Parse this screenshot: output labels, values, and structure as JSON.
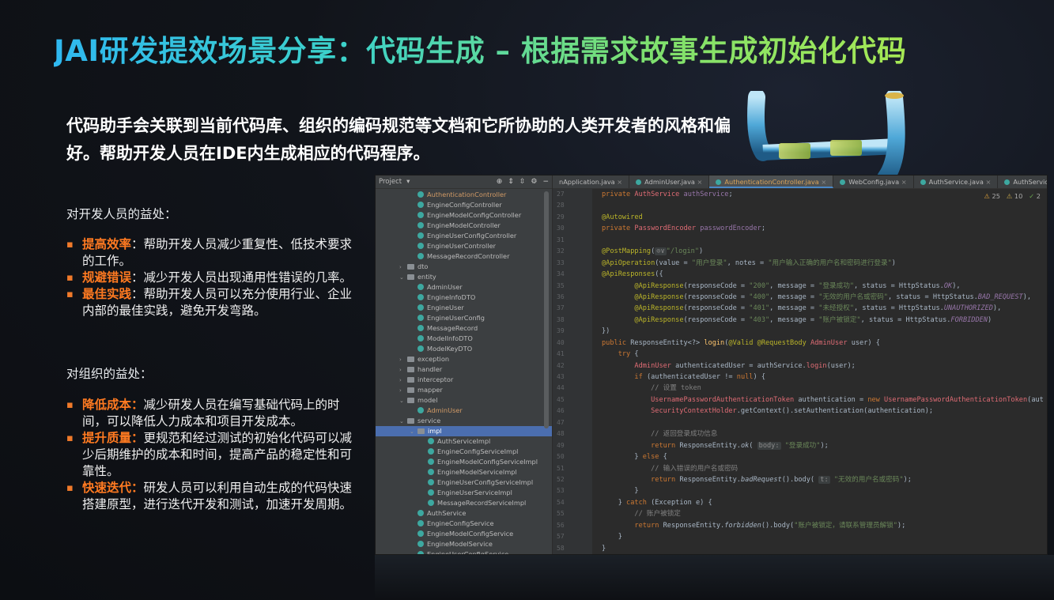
{
  "title": "JAI研发提效场景分享：代码生成 – 根据需求故事生成初始化代码",
  "intro": "代码助手会关联到当前代码库、组织的编码规范等文档和它所协助的人类开发者的风格和偏好。帮助开发人员在IDE内生成相应的代码程序。",
  "dev": {
    "heading": "对开发人员的益处：",
    "items": [
      {
        "label": "提高效率",
        "text": "：帮助开发人员减少重复性、低技术要求的工作。"
      },
      {
        "label": "规避错误",
        "text": "：减少开发人员出现通用性错误的几率。"
      },
      {
        "label": "最佳实践",
        "text": "：帮助开发人员可以充分使用行业、企业内部的最佳实践，避免开发弯路。"
      }
    ]
  },
  "org": {
    "heading": "对组织的益处：",
    "items": [
      {
        "label": "降低成本：",
        "text": "减少研发人员在编写基础代码上的时间，可以降低人力成本和项目开发成本。"
      },
      {
        "label": "提升质量：",
        "text": "更规范和经过测试的初始化代码可以减少后期维护的成本和时间，提高产品的稳定性和可靠性。"
      },
      {
        "label": "快速迭代：",
        "text": "研发人员可以利用自动生成的代码快速搭建原型，进行迭代开发和测试，加速开发周期。"
      }
    ]
  },
  "ide": {
    "project_label": "Project",
    "tabs": [
      "nApplication.java",
      "AdminUser.java",
      "AuthenticationController.java",
      "WebConfig.java",
      "AuthService.java",
      "AuthServiceImpl.java"
    ],
    "active_tab": 2,
    "status": {
      "warnings": "25",
      "weak": "10",
      "typos": "2"
    },
    "tree": [
      {
        "t": "AuthenticationController",
        "k": "c",
        "d": 5,
        "o": true
      },
      {
        "t": "EngineConfigController",
        "k": "c",
        "d": 5
      },
      {
        "t": "EngineModelConfigController",
        "k": "c",
        "d": 5
      },
      {
        "t": "EngineModelController",
        "k": "c",
        "d": 5
      },
      {
        "t": "EngineUserConfigController",
        "k": "c",
        "d": 5
      },
      {
        "t": "EngineUserController",
        "k": "c",
        "d": 5
      },
      {
        "t": "MessageRecordController",
        "k": "c",
        "d": 5
      },
      {
        "t": "dto",
        "k": "f",
        "d": 4,
        "a": "›"
      },
      {
        "t": "entity",
        "k": "f",
        "d": 4,
        "a": "⌄"
      },
      {
        "t": "AdminUser",
        "k": "c",
        "d": 5
      },
      {
        "t": "EngineInfoDTO",
        "k": "c",
        "d": 5
      },
      {
        "t": "EngineUser",
        "k": "c",
        "d": 5
      },
      {
        "t": "EngineUserConfig",
        "k": "c",
        "d": 5
      },
      {
        "t": "MessageRecord",
        "k": "c",
        "d": 5
      },
      {
        "t": "ModelInfoDTO",
        "k": "c",
        "d": 5
      },
      {
        "t": "ModelKeyDTO",
        "k": "c",
        "d": 5
      },
      {
        "t": "exception",
        "k": "f",
        "d": 4,
        "a": "›"
      },
      {
        "t": "handler",
        "k": "f",
        "d": 4,
        "a": "›"
      },
      {
        "t": "interceptor",
        "k": "f",
        "d": 4,
        "a": "›"
      },
      {
        "t": "mapper",
        "k": "f",
        "d": 4,
        "a": "›"
      },
      {
        "t": "model",
        "k": "f",
        "d": 4,
        "a": "⌄"
      },
      {
        "t": "AdminUser",
        "k": "c",
        "d": 5,
        "o": true
      },
      {
        "t": "service",
        "k": "f",
        "d": 4,
        "a": "⌄"
      },
      {
        "t": "impl",
        "k": "f",
        "d": 5,
        "a": "⌄",
        "s": true
      },
      {
        "t": "AuthServiceImpl",
        "k": "c",
        "d": 6
      },
      {
        "t": "EngineConfigServiceImpl",
        "k": "c",
        "d": 6
      },
      {
        "t": "EngineModelConfigServiceImpl",
        "k": "c",
        "d": 6
      },
      {
        "t": "EngineModelServiceImpl",
        "k": "c",
        "d": 6
      },
      {
        "t": "EngineUserConfigServiceImpl",
        "k": "c",
        "d": 6
      },
      {
        "t": "EngineUserServiceImpl",
        "k": "c",
        "d": 6
      },
      {
        "t": "MessageRecordServiceImpl",
        "k": "c",
        "d": 6
      },
      {
        "t": "AuthService",
        "k": "c",
        "d": 5
      },
      {
        "t": "EngineConfigService",
        "k": "c",
        "d": 5
      },
      {
        "t": "EngineModelConfigService",
        "k": "c",
        "d": 5
      },
      {
        "t": "EngineModelService",
        "k": "c",
        "d": 5
      },
      {
        "t": "EngineUserConfigService",
        "k": "c",
        "d": 5
      }
    ],
    "line_numbers": [
      "27",
      "28",
      "29",
      "30",
      "31",
      "32",
      "33",
      "34",
      "35",
      "36",
      "37",
      "38",
      "39",
      "40",
      "41",
      "42",
      "43",
      "44",
      "45",
      "46",
      "47",
      "48",
      "49",
      "50",
      "51",
      "52",
      "53",
      "54",
      "55",
      "56",
      "57",
      "58"
    ],
    "code": [
      "<span class=kw>private</span> <span class=red>AuthService</span> <span class=fld>authService</span>;",
      "",
      "<span class=an>@Autowired</span>",
      "<span class=kw>private</span> <span class=red>PasswordEncoder</span> <span class=fld>passwordEncoder</span>;",
      "",
      "<span class=an>@PostMapping</span>(<span class=hint>⊙∨</span><span class=str>\"/login\"</span>)",
      "<span class=an>@ApiOperation</span>(value = <span class=str>\"用户登录\"</span>, notes = <span class=str>\"用户输入正确的用户名和密码进行登录\"</span>)",
      "<span class=an>@ApiResponses</span>({",
      "        <span class=an>@ApiResponse</span>(responseCode = <span class=str>\"200\"</span>, message = <span class=str>\"登录成功\"</span>, status = HttpStatus.<span class=it>OK</span>),",
      "        <span class=an>@ApiResponse</span>(responseCode = <span class=str>\"400\"</span>, message = <span class=str>\"无效的用户名或密码\"</span>, status = HttpStatus.<span class=it>BAD_REQUEST</span>),",
      "        <span class=an>@ApiResponse</span>(responseCode = <span class=str>\"401\"</span>, message = <span class=str>\"未经授权\"</span>, status = HttpStatus.<span class=it>UNAUTHORIZED</span>),",
      "        <span class=an>@ApiResponse</span>(responseCode = <span class=str>\"403\"</span>, message = <span class=str>\"账户被锁定\"</span>, status = HttpStatus.<span class=it>FORBIDDEN</span>)",
      "})",
      "<span class=kw>public</span> ResponseEntity&lt;?&gt; <span style=\"color:#ffc66d\">login</span>(<span class=an>@Valid</span> <span class=an>@RequestBody</span> <span class=red>AdminUser</span> user) {",
      "    <span class=kw>try</span> {",
      "        <span class=red>AdminUser</span> authenticatedUser = authService.<span class=red>login</span>(user);",
      "        <span class=kw>if</span> (authenticatedUser != <span class=kw>null</span>) {",
      "            <span class=cm>// 设置 token</span>",
      "            <span class=red>UsernamePasswordAuthenticationToken</span> authentication = <span class=kw>new</span> <span class=red>UsernamePasswordAuthenticationToken</span>(aut",
      "            <span class=red>SecurityContextHolder</span>.getContext().setAuthentication(authentication);",
      "",
      "            <span class=cm>// 返回登录成功信息</span>",
      "            <span class=kw>return</span> ResponseEntity.<i>ok</i>( <span class=hint>body:</span> <span class=str>\"登录成功\"</span>);",
      "        } <span class=kw>else</span> {",
      "            <span class=cm>// 输入错误的用户名或密码</span>",
      "            <span class=kw>return</span> ResponseEntity.<i>badRequest</i>().body( <span class=hint>t:</span> <span class=str>\"无效的用户名或密码\"</span>);",
      "        }",
      "    } <span class=kw>catch</span> (Exception e) {",
      "        <span class=cm>// 账户被锁定</span>",
      "        <span class=kw>return</span> ResponseEntity.<i>forbidden</i>().body(<span class=str>\"账户被锁定，请联系管理员解锁\"</span>);",
      "    }",
      "}"
    ]
  }
}
